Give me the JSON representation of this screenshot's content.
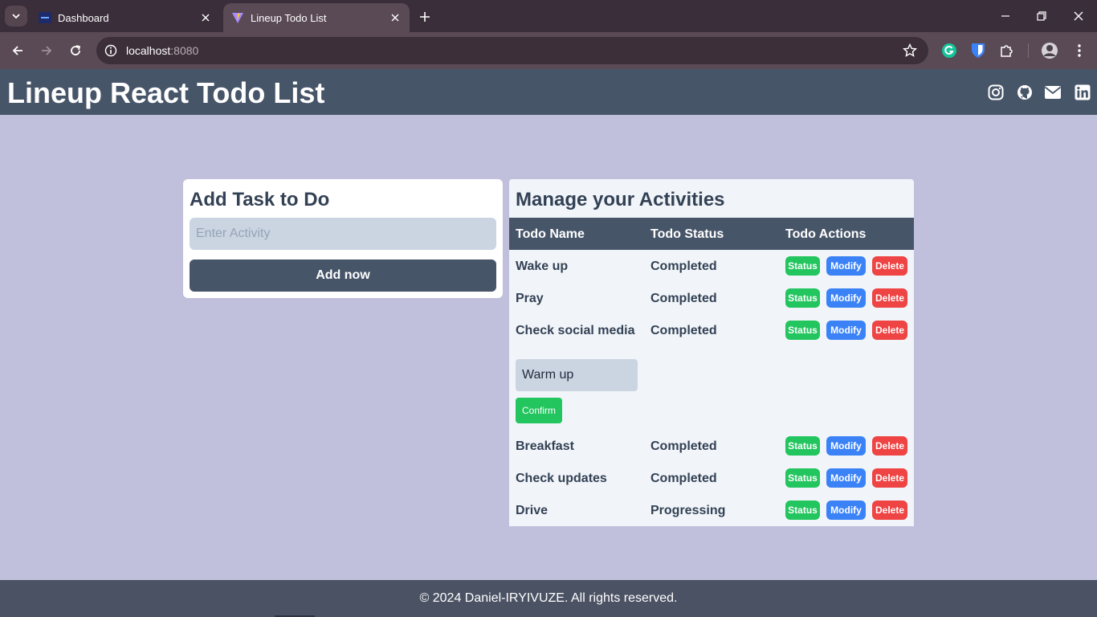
{
  "browser": {
    "tabs": [
      {
        "title": "Dashboard",
        "active": false
      },
      {
        "title": "Lineup Todo List",
        "active": true
      }
    ],
    "url_host": "localhost",
    "url_port": ":8080"
  },
  "app": {
    "title": "Lineup React Todo List",
    "social_icons": [
      "instagram-icon",
      "github-icon",
      "envelope-icon",
      "linkedin-icon"
    ]
  },
  "add_task": {
    "heading": "Add Task to Do",
    "input_placeholder": "Enter Activity",
    "input_value": "",
    "button_label": "Add now"
  },
  "manage": {
    "heading": "Manage your Activities",
    "columns": [
      "Todo Name",
      "Todo Status",
      "Todo Actions"
    ],
    "action_labels": {
      "status": "Status",
      "modify": "Modify",
      "delete": "Delete"
    },
    "rows": [
      {
        "name": "Wake up",
        "status": "Completed"
      },
      {
        "name": "Pray",
        "status": "Completed"
      },
      {
        "name": "Check social media",
        "status": "Completed"
      },
      {
        "name": "Breakfast",
        "status": "Completed"
      },
      {
        "name": "Check updates",
        "status": "Completed"
      },
      {
        "name": "Drive",
        "status": "Progressing"
      }
    ],
    "edit_row": {
      "value": "Warm up",
      "confirm_label": "Confirm"
    }
  },
  "footer": {
    "text": "© 2024 Daniel-IRYIVUZE. All rights reserved."
  },
  "colors": {
    "header_bg": "#475569",
    "page_bg": "#c0bfdc",
    "status_button": "#22c55e",
    "modify_button": "#3b82f6",
    "delete_button": "#ef4444",
    "footer_bg": "#4b5264"
  }
}
